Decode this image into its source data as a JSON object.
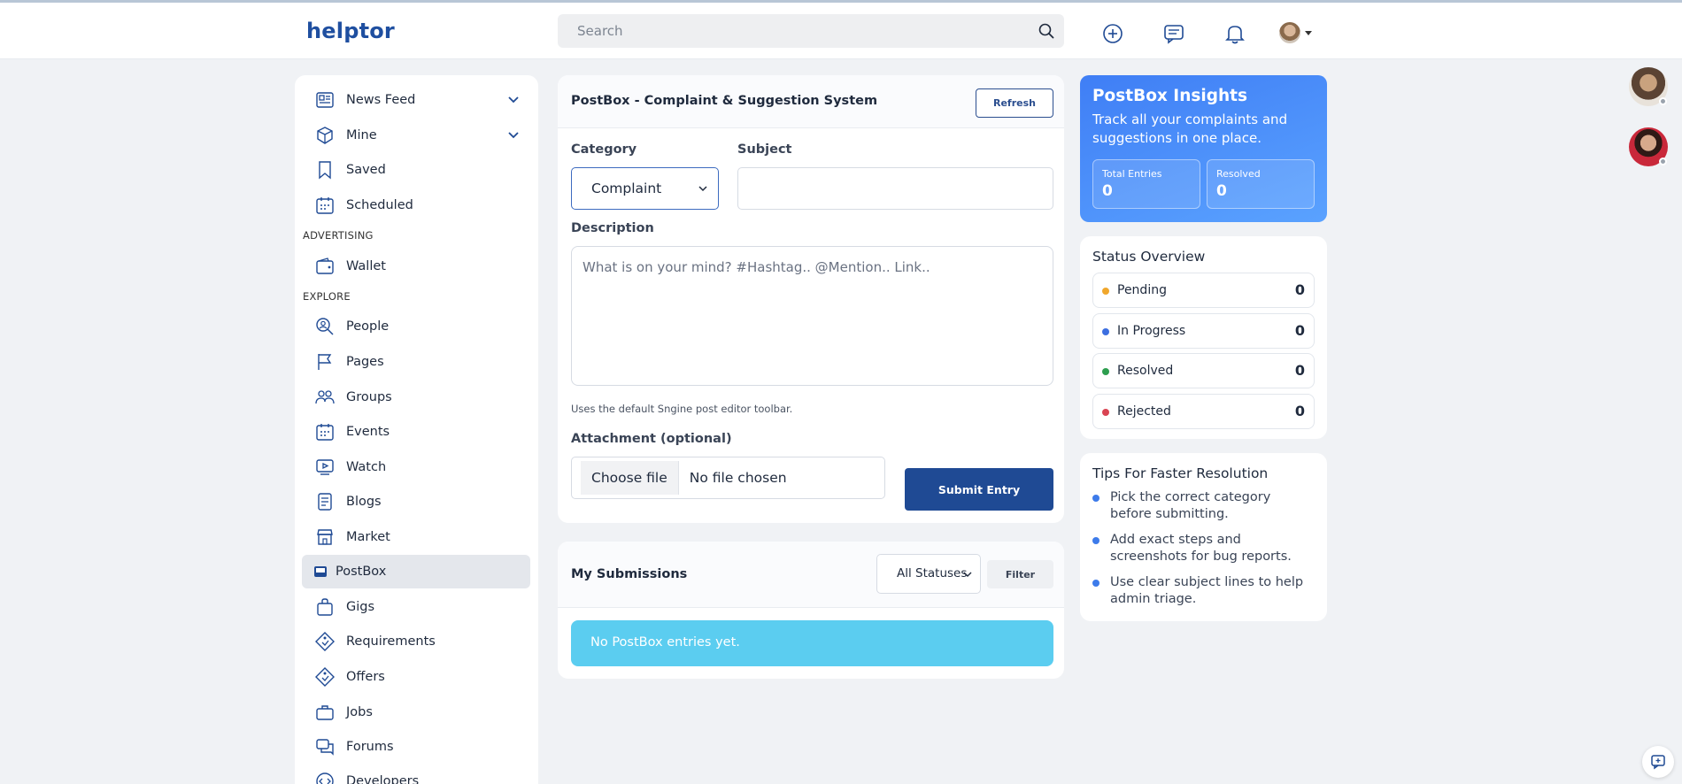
{
  "brand": {
    "name": "helptor",
    "color": "#1f4fa0"
  },
  "search": {
    "placeholder": "Search"
  },
  "topbar": {
    "icons": [
      "add-icon",
      "messages-icon",
      "bell-icon"
    ]
  },
  "sidebar": {
    "items": [
      {
        "label": "News Feed",
        "icon": "news-feed-icon",
        "expandable": true
      },
      {
        "label": "Mine",
        "icon": "cube-icon",
        "expandable": true
      },
      {
        "label": "Saved",
        "icon": "bookmark-icon"
      },
      {
        "label": "Scheduled",
        "icon": "calendar-icon"
      }
    ],
    "section_advertising": "ADVERTISING",
    "advertising_items": [
      {
        "label": "Wallet",
        "icon": "wallet-icon"
      }
    ],
    "section_explore": "EXPLORE",
    "explore_items": [
      {
        "label": "People",
        "icon": "people-search-icon"
      },
      {
        "label": "Pages",
        "icon": "flag-icon"
      },
      {
        "label": "Groups",
        "icon": "groups-icon"
      },
      {
        "label": "Events",
        "icon": "calendar-icon"
      },
      {
        "label": "Watch",
        "icon": "watch-icon"
      },
      {
        "label": "Blogs",
        "icon": "blog-icon"
      },
      {
        "label": "Market",
        "icon": "store-icon"
      },
      {
        "label": "PostBox",
        "icon": "inbox-icon",
        "active": true
      },
      {
        "label": "Gigs",
        "icon": "bag-icon"
      },
      {
        "label": "Requirements",
        "icon": "tag-icon"
      },
      {
        "label": "Offers",
        "icon": "tag-icon"
      },
      {
        "label": "Jobs",
        "icon": "briefcase-icon"
      },
      {
        "label": "Forums",
        "icon": "forum-icon"
      },
      {
        "label": "Developers",
        "icon": "code-icon"
      }
    ]
  },
  "postbox": {
    "title": "PostBox - Complaint & Suggestion System",
    "refresh_label": "Refresh",
    "category_label": "Category",
    "category_value": "Complaint",
    "subject_label": "Subject",
    "subject_value": "",
    "description_label": "Description",
    "description_placeholder": "What is on your mind? #Hashtag.. @Mention.. Link..",
    "editor_hint": "Uses the default Sngine post editor toolbar.",
    "attachment_label": "Attachment (optional)",
    "choose_file_label": "Choose file",
    "no_file_label": "No file chosen",
    "submit_label": "Submit Entry"
  },
  "submissions": {
    "title": "My Submissions",
    "status_filter_value": "All Statuses",
    "filter_label": "Filter",
    "empty_message": "No PostBox entries yet."
  },
  "insights": {
    "title": "PostBox Insights",
    "subtitle": "Track all your complaints and suggestions in one place.",
    "total_label": "Total Entries",
    "total_value": "0",
    "resolved_label": "Resolved",
    "resolved_value": "0"
  },
  "status_overview": {
    "title": "Status Overview",
    "rows": [
      {
        "name": "Pending",
        "count": "0",
        "color": "#f0a72c"
      },
      {
        "name": "In Progress",
        "count": "0",
        "color": "#3d6fe0"
      },
      {
        "name": "Resolved",
        "count": "0",
        "color": "#2e9e4f"
      },
      {
        "name": "Rejected",
        "count": "0",
        "color": "#d94452"
      }
    ]
  },
  "tips": {
    "title": "Tips For Faster Resolution",
    "items": [
      "Pick the correct category before submitting.",
      "Add exact steps and screenshots for bug reports.",
      "Use clear subject lines to help admin triage."
    ]
  }
}
